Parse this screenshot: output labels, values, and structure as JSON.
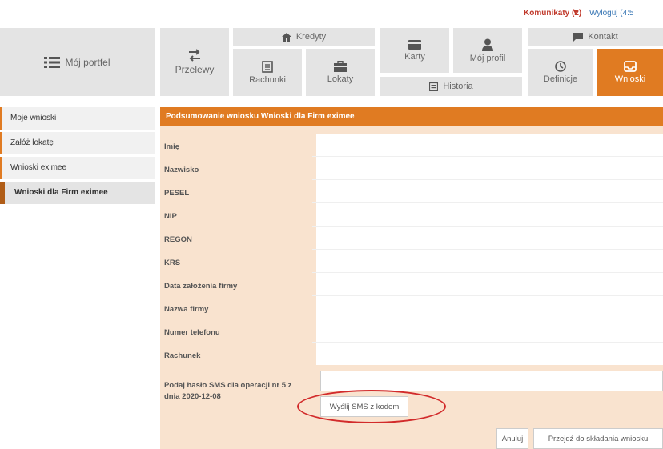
{
  "topbar": {
    "messages_label": "Komunikaty (2)",
    "caret": "▾",
    "logout_label": "Wyloguj (4:5"
  },
  "nav": {
    "portfolio": "Mój portfel",
    "transfers": "Przelewy",
    "credits": "Kredyty",
    "accounts": "Rachunki",
    "deposits": "Lokaty",
    "cards": "Karty",
    "profile": "Mój profil",
    "history": "Historia",
    "contact": "Kontakt",
    "definitions": "Definicje",
    "applications": "Wnioski"
  },
  "sidebar": {
    "items": [
      {
        "label": "Moje wnioski"
      },
      {
        "label": "Załóż lokatę"
      },
      {
        "label": "Wnioski eximee"
      },
      {
        "label": "Wnioski dla Firm eximee"
      }
    ]
  },
  "panel": {
    "title": "Podsumowanie wniosku Wnioski dla Firm eximee",
    "fields": [
      {
        "label": "Imię"
      },
      {
        "label": "Nazwisko"
      },
      {
        "label": "PESEL"
      },
      {
        "label": "NIP"
      },
      {
        "label": "REGON"
      },
      {
        "label": "KRS"
      },
      {
        "label": "Data założenia firmy"
      },
      {
        "label": "Nazwa firmy"
      },
      {
        "label": "Numer telefonu"
      },
      {
        "label": "Rachunek"
      }
    ],
    "sms_label": "Podaj hasło SMS dla operacji nr 5 z dnia 2020-12-08",
    "send_sms_button": "Wyślij SMS z kodem",
    "cancel_button": "Anuluj",
    "proceed_button": "Przejdź do składania wniosku"
  },
  "colors": {
    "accent": "#e07b22",
    "panel_bg": "#f9e3cf",
    "highlight_circle": "#d22b2b"
  }
}
